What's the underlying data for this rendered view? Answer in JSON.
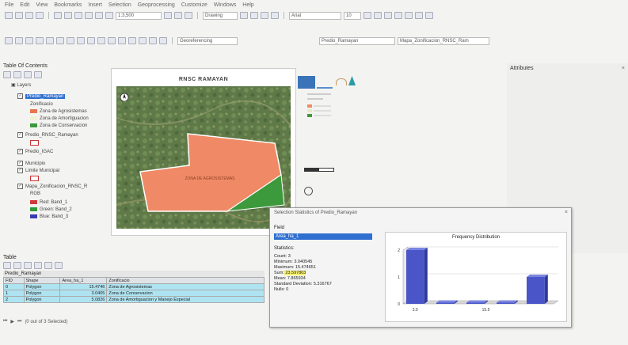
{
  "menu": [
    "File",
    "Edit",
    "View",
    "Bookmarks",
    "Insert",
    "Selection",
    "Geoprocessing",
    "Customize",
    "Windows",
    "Help"
  ],
  "toolbar": {
    "scale": "1:3,500",
    "drawing": "Drawing",
    "font": "Arial",
    "font_size": "10",
    "georeferencing": "Georeferencing",
    "layer": "Predio_Ramayan",
    "map_doc": "Mapa_Zonificacion_RNSC_Ram"
  },
  "toc": {
    "title": "Table Of Contents",
    "layers_root": "Layers",
    "items": [
      {
        "label": "Predio_Ramayan",
        "kind": "layer",
        "selected": true
      },
      {
        "label": "Zonificacio",
        "kind": "heading"
      },
      {
        "label": "Zona de Agrosistemas",
        "kind": "legend",
        "color": "#e8764f"
      },
      {
        "label": "Zona de Amortiguacion",
        "kind": "legend",
        "color": "#f0f0d8"
      },
      {
        "label": "Zona de Conservacion",
        "kind": "legend",
        "color": "#3a9a3a"
      },
      {
        "label": "Predio_RNSC_Ramayan",
        "kind": "layer"
      },
      {
        "label": "",
        "kind": "legend-box",
        "color": "#ffffff"
      },
      {
        "label": "Predio_IGAC",
        "kind": "layer"
      },
      {
        "label": "Municipio",
        "kind": "layer"
      },
      {
        "label": "Limite Municipal",
        "kind": "layer"
      },
      {
        "label": "",
        "kind": "legend-box",
        "color": "#ffffff"
      },
      {
        "label": "Mapa_Zonificacion_RNSC_R",
        "kind": "layer"
      },
      {
        "label": "RGB",
        "kind": "heading"
      },
      {
        "label": "Red: Band_1",
        "kind": "legend",
        "color": "#d23a3a"
      },
      {
        "label": "Green: Band_2",
        "kind": "legend",
        "color": "#2f9a3a"
      },
      {
        "label": "Blue: Band_3",
        "kind": "legend",
        "color": "#3a3ab4"
      }
    ]
  },
  "map": {
    "title": "RNSC RAMAYAN",
    "zone_label": "ZONA DE AGROSISTEMAS"
  },
  "attributes_panel": {
    "title": "Attributes"
  },
  "table": {
    "panel_title": "Table",
    "layer_name": "Predio_Ramayan",
    "columns": [
      "FID",
      "Shape",
      "Area_ha_1",
      "Zonificacio"
    ],
    "rows": [
      {
        "fid": "0",
        "shape": "Polygon",
        "area": "15.4746",
        "zone": "Zona de Agrosistemas"
      },
      {
        "fid": "1",
        "shape": "Polygon",
        "area": "3.0405",
        "zone": "Zona de Conservacion"
      },
      {
        "fid": "2",
        "shape": "Polygon",
        "area": "5.0826",
        "zone": "Zona de Amortiguacion y Manejo Especial"
      }
    ],
    "footer": "(0 out of 3 Selected)"
  },
  "stats_dialog": {
    "title": "Selection Statistics of Predio_Ramayan",
    "field_label": "Field",
    "field_value": "Area_ha_1",
    "stats_label": "Statistics:",
    "stats": [
      {
        "k": "Count:",
        "v": "3"
      },
      {
        "k": "Minimum:",
        "v": "3.040545"
      },
      {
        "k": "Maximum:",
        "v": "15.474651"
      },
      {
        "k": "Sum:",
        "v": "23.597803"
      },
      {
        "k": "Mean:",
        "v": "7.865934"
      },
      {
        "k": "Standard Deviation:",
        "v": "5.316767"
      },
      {
        "k": "Nulls:",
        "v": "0"
      }
    ],
    "chart_title": "Frequency Distribution"
  },
  "chart_data": {
    "type": "bar",
    "title": "Frequency Distribution",
    "xlabel": "",
    "ylabel": "",
    "tick_labels_x": [
      "3.0",
      "15.5"
    ],
    "tick_labels_y": [
      "0",
      "1",
      "2"
    ],
    "ylim": [
      0,
      2
    ],
    "values": [
      2,
      0,
      0,
      0,
      1
    ],
    "colors": {
      "bar": "#4a56c8"
    }
  },
  "colors": {
    "agro": "#f08a66",
    "conservation": "#3c9a3c",
    "selected_highlight": "#2f6fd0",
    "table_selection": "#aee4f2",
    "bar": "#4a56c8"
  }
}
